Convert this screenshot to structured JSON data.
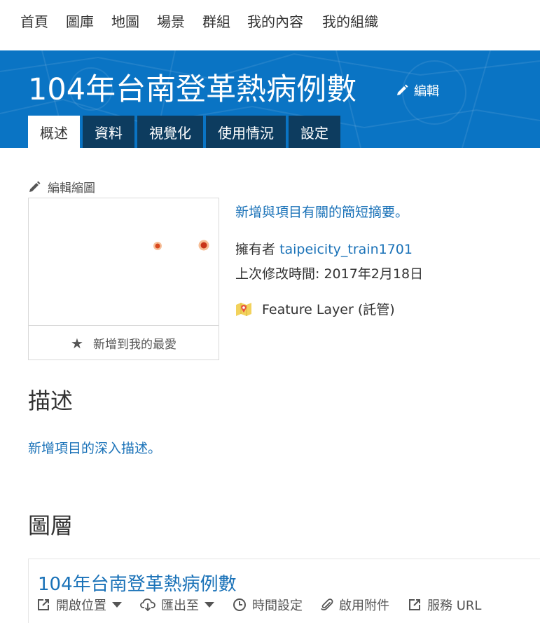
{
  "nav": {
    "items": [
      "首頁",
      "圖庫",
      "地圖",
      "場景",
      "群組",
      "我的內容",
      "我的組織"
    ]
  },
  "item": {
    "title": "104年台南登革熱病例數",
    "edit_label": "編輯"
  },
  "tabs": [
    "概述",
    "資料",
    "視覺化",
    "使用情況",
    "設定"
  ],
  "overview": {
    "edit_thumbnail_label": "編輯縮圖",
    "add_favorite_label": "新增到我的最愛",
    "summary_placeholder": "新增與項目有關的簡短摘要。",
    "owner_label": "擁有者",
    "owner_name": "taipeicity_train1701",
    "modified_label": "上次修改時間:",
    "modified_value": "2017年2月18日",
    "item_type": "Feature Layer (託管)"
  },
  "description": {
    "heading": "描述",
    "placeholder": "新增項目的深入描述。"
  },
  "layers": {
    "heading": "圖層",
    "layer_title": "104年台南登革熱病例數",
    "actions": {
      "open": "開啟位置",
      "export": "匯出至",
      "time": "時間設定",
      "attachments": "啟用附件",
      "service_url": "服務 URL"
    }
  },
  "colors": {
    "banner": "#0a74c4",
    "tab_bg": "#0d3c5f",
    "link": "#1a72b8"
  }
}
